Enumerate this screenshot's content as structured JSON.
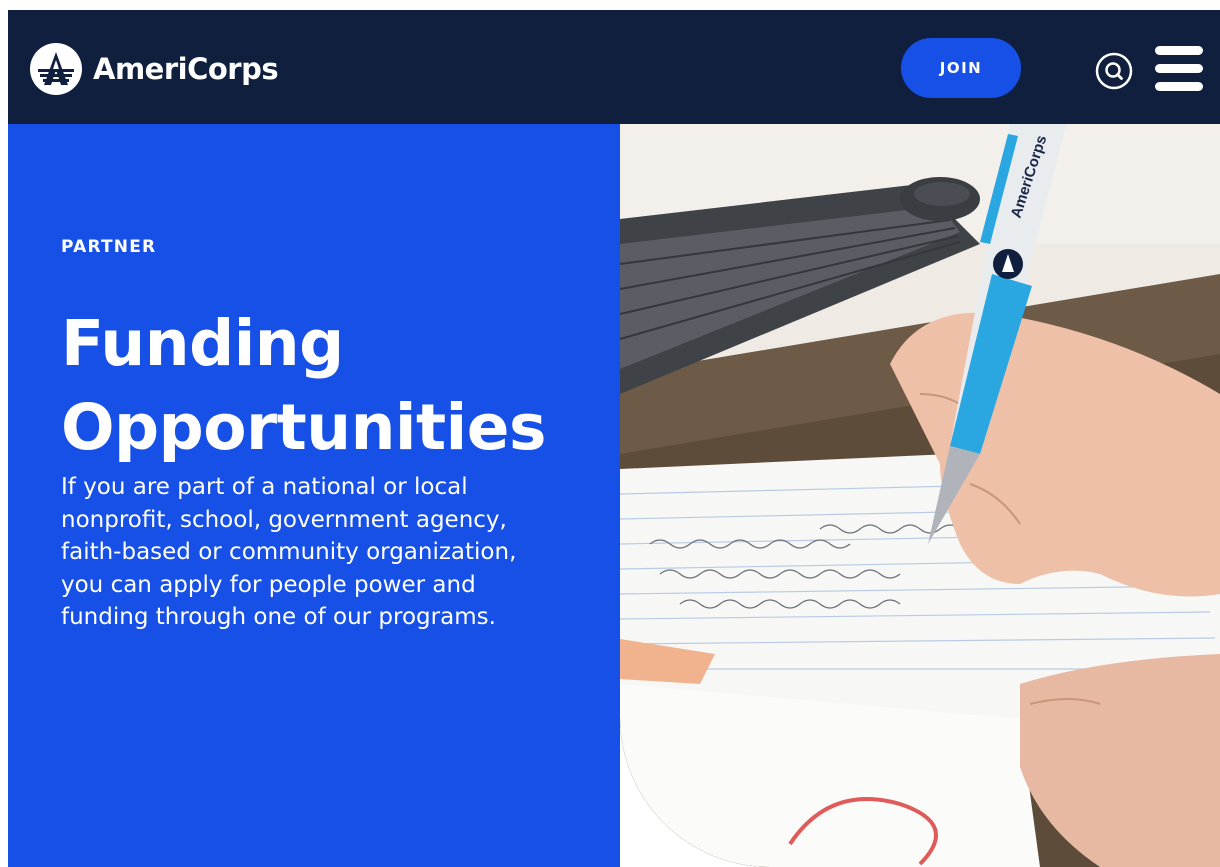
{
  "header": {
    "brand_name": "AmeriCorps",
    "join_label": "JOIN",
    "search_icon": "search-icon",
    "menu_icon": "hamburger-menu-icon"
  },
  "hero": {
    "eyebrow": "PARTNER",
    "title": "Funding Opportunities",
    "description": "If you are part of a national or local nonprofit, school, government agency, faith-based or community organization, you can apply for people power and funding through one of our programs.",
    "pen_brand": "AmeriCorps"
  },
  "colors": {
    "header_bg": "#0f1f3d",
    "accent_blue": "#1650e6",
    "text_white": "#ffffff"
  }
}
